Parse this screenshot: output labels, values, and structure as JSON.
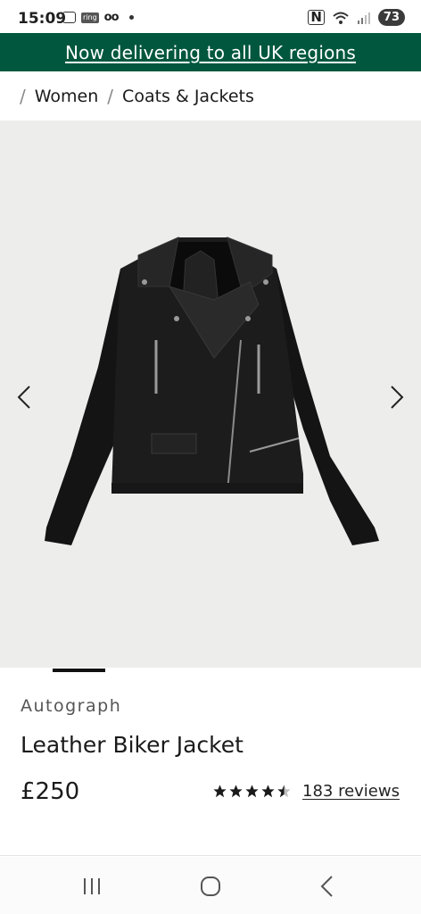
{
  "status_bar": {
    "time": "15:09",
    "ring_label": "ring",
    "voicemail": "oo",
    "battery": "73"
  },
  "promo": {
    "text": "Now delivering to all UK regions"
  },
  "breadcrumb": {
    "items": [
      "Women",
      "Coats & Jackets"
    ]
  },
  "product": {
    "brand": "Autograph",
    "title": "Leather Biker Jacket",
    "price": "£250",
    "rating": 4.5,
    "reviews_label": "183 reviews"
  },
  "icons": {
    "gallery_prev": "chevron-left-icon",
    "gallery_next": "chevron-right-icon",
    "nav_recent": "recent-apps-icon",
    "nav_home": "home-icon",
    "nav_back": "back-icon"
  },
  "colors": {
    "banner": "#00573d",
    "gallery_bg": "#ededec"
  }
}
